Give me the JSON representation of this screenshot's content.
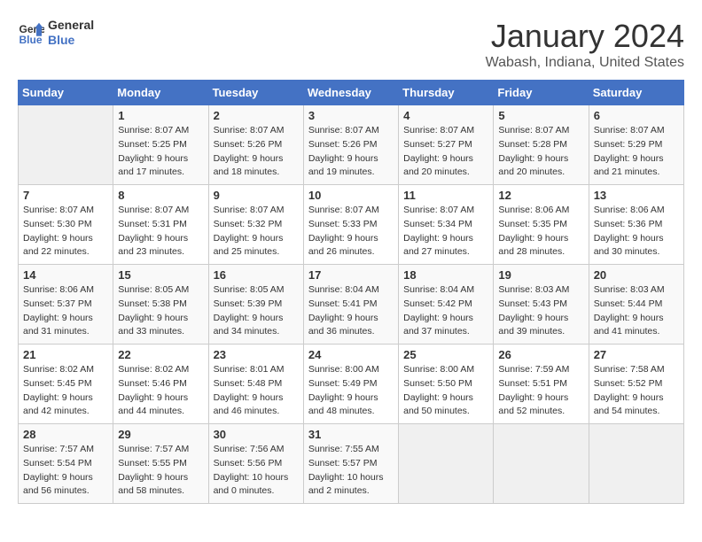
{
  "header": {
    "logo_line1": "General",
    "logo_line2": "Blue",
    "month_title": "January 2024",
    "subtitle": "Wabash, Indiana, United States"
  },
  "days_of_week": [
    "Sunday",
    "Monday",
    "Tuesday",
    "Wednesday",
    "Thursday",
    "Friday",
    "Saturday"
  ],
  "weeks": [
    [
      {
        "num": "",
        "sunrise": "",
        "sunset": "",
        "daylight": ""
      },
      {
        "num": "1",
        "sunrise": "Sunrise: 8:07 AM",
        "sunset": "Sunset: 5:25 PM",
        "daylight": "Daylight: 9 hours and 17 minutes."
      },
      {
        "num": "2",
        "sunrise": "Sunrise: 8:07 AM",
        "sunset": "Sunset: 5:26 PM",
        "daylight": "Daylight: 9 hours and 18 minutes."
      },
      {
        "num": "3",
        "sunrise": "Sunrise: 8:07 AM",
        "sunset": "Sunset: 5:26 PM",
        "daylight": "Daylight: 9 hours and 19 minutes."
      },
      {
        "num": "4",
        "sunrise": "Sunrise: 8:07 AM",
        "sunset": "Sunset: 5:27 PM",
        "daylight": "Daylight: 9 hours and 20 minutes."
      },
      {
        "num": "5",
        "sunrise": "Sunrise: 8:07 AM",
        "sunset": "Sunset: 5:28 PM",
        "daylight": "Daylight: 9 hours and 20 minutes."
      },
      {
        "num": "6",
        "sunrise": "Sunrise: 8:07 AM",
        "sunset": "Sunset: 5:29 PM",
        "daylight": "Daylight: 9 hours and 21 minutes."
      }
    ],
    [
      {
        "num": "7",
        "sunrise": "Sunrise: 8:07 AM",
        "sunset": "Sunset: 5:30 PM",
        "daylight": "Daylight: 9 hours and 22 minutes."
      },
      {
        "num": "8",
        "sunrise": "Sunrise: 8:07 AM",
        "sunset": "Sunset: 5:31 PM",
        "daylight": "Daylight: 9 hours and 23 minutes."
      },
      {
        "num": "9",
        "sunrise": "Sunrise: 8:07 AM",
        "sunset": "Sunset: 5:32 PM",
        "daylight": "Daylight: 9 hours and 25 minutes."
      },
      {
        "num": "10",
        "sunrise": "Sunrise: 8:07 AM",
        "sunset": "Sunset: 5:33 PM",
        "daylight": "Daylight: 9 hours and 26 minutes."
      },
      {
        "num": "11",
        "sunrise": "Sunrise: 8:07 AM",
        "sunset": "Sunset: 5:34 PM",
        "daylight": "Daylight: 9 hours and 27 minutes."
      },
      {
        "num": "12",
        "sunrise": "Sunrise: 8:06 AM",
        "sunset": "Sunset: 5:35 PM",
        "daylight": "Daylight: 9 hours and 28 minutes."
      },
      {
        "num": "13",
        "sunrise": "Sunrise: 8:06 AM",
        "sunset": "Sunset: 5:36 PM",
        "daylight": "Daylight: 9 hours and 30 minutes."
      }
    ],
    [
      {
        "num": "14",
        "sunrise": "Sunrise: 8:06 AM",
        "sunset": "Sunset: 5:37 PM",
        "daylight": "Daylight: 9 hours and 31 minutes."
      },
      {
        "num": "15",
        "sunrise": "Sunrise: 8:05 AM",
        "sunset": "Sunset: 5:38 PM",
        "daylight": "Daylight: 9 hours and 33 minutes."
      },
      {
        "num": "16",
        "sunrise": "Sunrise: 8:05 AM",
        "sunset": "Sunset: 5:39 PM",
        "daylight": "Daylight: 9 hours and 34 minutes."
      },
      {
        "num": "17",
        "sunrise": "Sunrise: 8:04 AM",
        "sunset": "Sunset: 5:41 PM",
        "daylight": "Daylight: 9 hours and 36 minutes."
      },
      {
        "num": "18",
        "sunrise": "Sunrise: 8:04 AM",
        "sunset": "Sunset: 5:42 PM",
        "daylight": "Daylight: 9 hours and 37 minutes."
      },
      {
        "num": "19",
        "sunrise": "Sunrise: 8:03 AM",
        "sunset": "Sunset: 5:43 PM",
        "daylight": "Daylight: 9 hours and 39 minutes."
      },
      {
        "num": "20",
        "sunrise": "Sunrise: 8:03 AM",
        "sunset": "Sunset: 5:44 PM",
        "daylight": "Daylight: 9 hours and 41 minutes."
      }
    ],
    [
      {
        "num": "21",
        "sunrise": "Sunrise: 8:02 AM",
        "sunset": "Sunset: 5:45 PM",
        "daylight": "Daylight: 9 hours and 42 minutes."
      },
      {
        "num": "22",
        "sunrise": "Sunrise: 8:02 AM",
        "sunset": "Sunset: 5:46 PM",
        "daylight": "Daylight: 9 hours and 44 minutes."
      },
      {
        "num": "23",
        "sunrise": "Sunrise: 8:01 AM",
        "sunset": "Sunset: 5:48 PM",
        "daylight": "Daylight: 9 hours and 46 minutes."
      },
      {
        "num": "24",
        "sunrise": "Sunrise: 8:00 AM",
        "sunset": "Sunset: 5:49 PM",
        "daylight": "Daylight: 9 hours and 48 minutes."
      },
      {
        "num": "25",
        "sunrise": "Sunrise: 8:00 AM",
        "sunset": "Sunset: 5:50 PM",
        "daylight": "Daylight: 9 hours and 50 minutes."
      },
      {
        "num": "26",
        "sunrise": "Sunrise: 7:59 AM",
        "sunset": "Sunset: 5:51 PM",
        "daylight": "Daylight: 9 hours and 52 minutes."
      },
      {
        "num": "27",
        "sunrise": "Sunrise: 7:58 AM",
        "sunset": "Sunset: 5:52 PM",
        "daylight": "Daylight: 9 hours and 54 minutes."
      }
    ],
    [
      {
        "num": "28",
        "sunrise": "Sunrise: 7:57 AM",
        "sunset": "Sunset: 5:54 PM",
        "daylight": "Daylight: 9 hours and 56 minutes."
      },
      {
        "num": "29",
        "sunrise": "Sunrise: 7:57 AM",
        "sunset": "Sunset: 5:55 PM",
        "daylight": "Daylight: 9 hours and 58 minutes."
      },
      {
        "num": "30",
        "sunrise": "Sunrise: 7:56 AM",
        "sunset": "Sunset: 5:56 PM",
        "daylight": "Daylight: 10 hours and 0 minutes."
      },
      {
        "num": "31",
        "sunrise": "Sunrise: 7:55 AM",
        "sunset": "Sunset: 5:57 PM",
        "daylight": "Daylight: 10 hours and 2 minutes."
      },
      {
        "num": "",
        "sunrise": "",
        "sunset": "",
        "daylight": ""
      },
      {
        "num": "",
        "sunrise": "",
        "sunset": "",
        "daylight": ""
      },
      {
        "num": "",
        "sunrise": "",
        "sunset": "",
        "daylight": ""
      }
    ]
  ]
}
